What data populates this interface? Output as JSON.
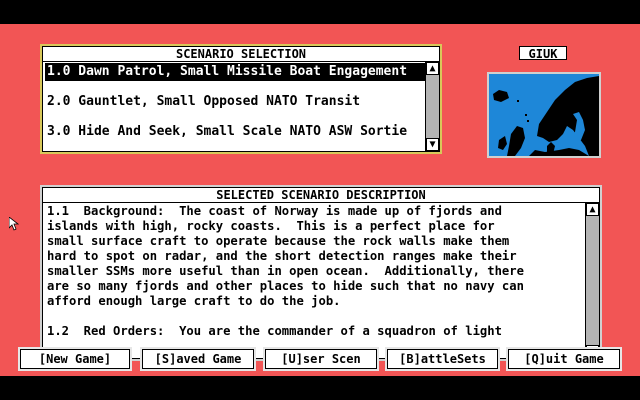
{
  "scenario_panel": {
    "title": "SCENARIO SELECTION",
    "items": [
      {
        "label": "1.0  Dawn Patrol, Small Missile Boat Engagement",
        "selected": true
      },
      {
        "label": "2.0  Gauntlet, Small Opposed NATO Transit",
        "selected": false
      },
      {
        "label": "3.0  Hide And Seek, Small Scale NATO ASW Sortie",
        "selected": false
      }
    ]
  },
  "map": {
    "label": "GIUK"
  },
  "description_panel": {
    "title": "SELECTED SCENARIO DESCRIPTION",
    "text": "1.1  Background:  The coast of Norway is made up of fjords and\nislands with high, rocky coasts.  This is a perfect place for\nsmall surface craft to operate because the rock walls make them\nhard to spot on radar, and the short detection ranges make their\nsmaller SSMs more useful than in open ocean.  Additionally, there\nare so many fjords and other places to hide such that no navy can\nafford enough large craft to do the job.\n\n1.2  Red Orders:  You are the commander of a squadron of light"
  },
  "buttons": {
    "new_game": "[New Game]",
    "saved_game": "[S]aved Game",
    "user_scen": "[U]ser Scen",
    "battlesets": "[B]attleSets",
    "quit_game": "[Q]uit Game"
  },
  "icons": {
    "scroll_up": "up-arrow-icon",
    "scroll_down": "down-arrow-icon",
    "pointer": "mouse-pointer-icon"
  },
  "colors": {
    "background": "#f25555",
    "map_sea": "#1e87d8",
    "land": "#000000"
  }
}
